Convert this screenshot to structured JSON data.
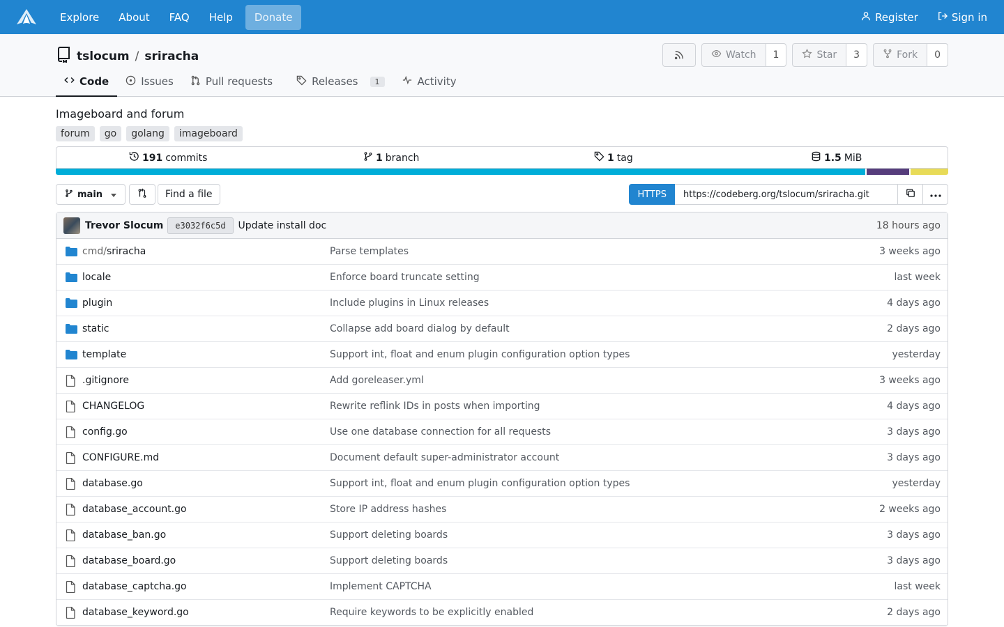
{
  "nav": {
    "links": [
      "Explore",
      "About",
      "FAQ",
      "Help"
    ],
    "donate": "Donate",
    "register": "Register",
    "signin": "Sign in"
  },
  "repo": {
    "owner": "tslocum",
    "name": "sriracha",
    "watch_label": "Watch",
    "watch_count": "1",
    "star_label": "Star",
    "star_count": "3",
    "fork_label": "Fork",
    "fork_count": "0",
    "description": "Imageboard and forum",
    "topics": [
      "forum",
      "go",
      "golang",
      "imageboard"
    ]
  },
  "tabs": [
    {
      "label": "Code",
      "icon": "code-icon"
    },
    {
      "label": "Issues",
      "icon": "issue-icon"
    },
    {
      "label": "Pull requests",
      "icon": "pull-request-icon"
    },
    {
      "label": "Releases",
      "icon": "tag-icon",
      "badge": "1"
    },
    {
      "label": "Activity",
      "icon": "pulse-icon"
    }
  ],
  "stats": {
    "commits_num": "191",
    "commits_label": "commits",
    "branch_num": "1",
    "branch_label": "branch",
    "tag_num": "1",
    "tag_label": "tag",
    "size_num": "1.5",
    "size_unit": "MiB"
  },
  "languages": [
    {
      "color": "#00add8",
      "share": 0.91
    },
    {
      "color": "#563d7c",
      "share": 0.048
    },
    {
      "color": "#e8db58",
      "share": 0.042
    }
  ],
  "toolbar": {
    "branch": "main",
    "find_file": "Find a file",
    "clone_protocol": "HTTPS",
    "clone_url": "https://codeberg.org/tslocum/sriracha.git"
  },
  "latest_commit": {
    "author": "Trevor Slocum",
    "sha": "e3032f6c5d",
    "message": "Update install doc",
    "time": "18 hours ago"
  },
  "files": [
    {
      "type": "dir",
      "prefix": "cmd/",
      "name": "sriracha",
      "message": "Parse templates",
      "time": "3 weeks ago"
    },
    {
      "type": "dir",
      "prefix": "",
      "name": "locale",
      "message": "Enforce board truncate setting",
      "time": "last week"
    },
    {
      "type": "dir",
      "prefix": "",
      "name": "plugin",
      "message": "Include plugins in Linux releases",
      "time": "4 days ago"
    },
    {
      "type": "dir",
      "prefix": "",
      "name": "static",
      "message": "Collapse add board dialog by default",
      "time": "2 days ago"
    },
    {
      "type": "dir",
      "prefix": "",
      "name": "template",
      "message": "Support int, float and enum plugin configuration option types",
      "time": "yesterday"
    },
    {
      "type": "file",
      "prefix": "",
      "name": ".gitignore",
      "message": "Add goreleaser.yml",
      "time": "3 weeks ago"
    },
    {
      "type": "file",
      "prefix": "",
      "name": "CHANGELOG",
      "message": "Rewrite reflink IDs in posts when importing",
      "time": "4 days ago"
    },
    {
      "type": "file",
      "prefix": "",
      "name": "config.go",
      "message": "Use one database connection for all requests",
      "time": "3 days ago"
    },
    {
      "type": "file",
      "prefix": "",
      "name": "CONFIGURE.md",
      "message": "Document default super-administrator account",
      "time": "3 days ago"
    },
    {
      "type": "file",
      "prefix": "",
      "name": "database.go",
      "message": "Support int, float and enum plugin configuration option types",
      "time": "yesterday"
    },
    {
      "type": "file",
      "prefix": "",
      "name": "database_account.go",
      "message": "Store IP address hashes",
      "time": "2 weeks ago"
    },
    {
      "type": "file",
      "prefix": "",
      "name": "database_ban.go",
      "message": "Support deleting boards",
      "time": "3 days ago"
    },
    {
      "type": "file",
      "prefix": "",
      "name": "database_board.go",
      "message": "Support deleting boards",
      "time": "3 days ago"
    },
    {
      "type": "file",
      "prefix": "",
      "name": "database_captcha.go",
      "message": "Implement CAPTCHA",
      "time": "last week"
    },
    {
      "type": "file",
      "prefix": "",
      "name": "database_keyword.go",
      "message": "Require keywords to be explicitly enabled",
      "time": "2 days ago"
    }
  ]
}
